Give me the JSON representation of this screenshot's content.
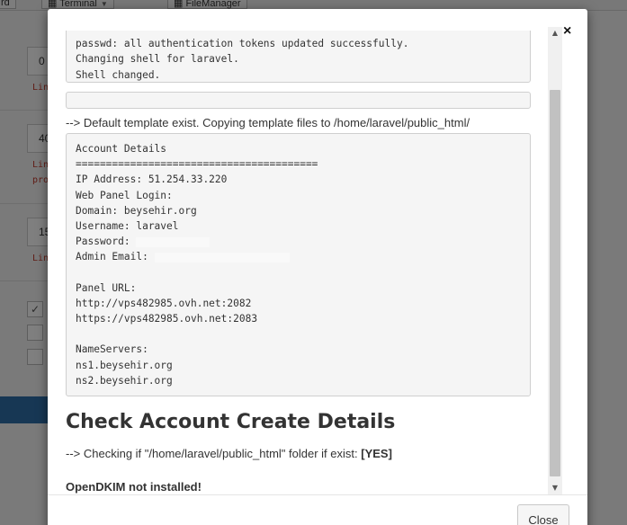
{
  "background": {
    "tabs": [
      {
        "label": "rd"
      },
      {
        "label": "Terminal"
      },
      {
        "label": "FileManager"
      }
    ],
    "fields": [
      "0",
      "40",
      "15"
    ],
    "red_labels": [
      "Lin",
      "Lin",
      "pro",
      "Lin"
    ]
  },
  "modal": {
    "close_icon": "×",
    "shell_output_lines": [
      "passwd: all authentication tokens updated successfully.",
      "Changing shell for laravel.",
      "Shell changed."
    ],
    "template_message": "--> Default template exist. Copying template files to /home/laravel/public_html/",
    "account_details_lines": [
      "Account Details",
      "========================================",
      "IP Address: 51.254.33.220",
      "Web Panel Login:",
      "Domain: beysehir.org",
      "Username: laravel",
      "Password: ",
      "Admin Email: ",
      "",
      "Panel URL:",
      "http://vps482985.ovh.net:2082",
      "https://vps482985.ovh.net:2083",
      "",
      "NameServers:",
      "ns1.beysehir.org",
      "ns2.beysehir.org"
    ],
    "heading": "Check Account Create Details",
    "check_message": "--> Checking if \"/home/laravel/public_html\" folder if exist: ",
    "check_result": "[YES]",
    "opendkim_message": "OpenDKIM not installed!",
    "close_button": "Close"
  }
}
